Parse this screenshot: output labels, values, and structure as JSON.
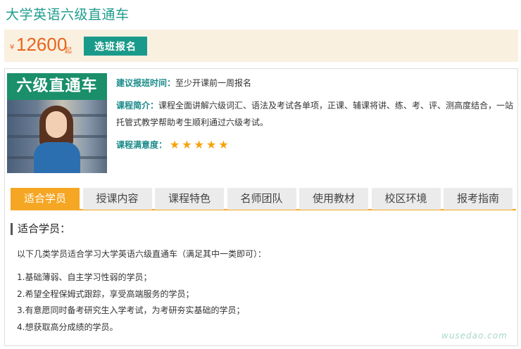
{
  "page": {
    "title": "大学英语六级直通车"
  },
  "price": {
    "currency": "¥",
    "value": "12600",
    "unit": "起"
  },
  "enroll_button": "选班报名",
  "cover": {
    "title": "六级直通车"
  },
  "info": {
    "schedule_label": "建议报班时间：",
    "schedule_value": "至少开课前一周报名",
    "intro_label": "课程简介：",
    "intro_value": "课程全面讲解六级词汇、语法及考试各单项，正课、辅课将讲、练、考、评、测高度结合，一站托管式教学帮助考生顺利通过六级考试。",
    "rating_label": "课程满意度：",
    "rating": 5
  },
  "tabs": [
    "适合学员",
    "授课内容",
    "课程特色",
    "名师团队",
    "使用教材",
    "校区环境",
    "报考指南"
  ],
  "active_tab": 0,
  "section": {
    "title": "适合学员：",
    "intro": "以下几类学员适合学习大学英语六级直通车（满足其中一类即可）：",
    "items": [
      "1.基础薄弱、自主学习性弱的学员；",
      "2.希望全程保姆式跟踪，享受高端服务的学员；",
      "3.有意愿同时备考研究生入学考试，为考研夯实基础的学员；",
      "4.想获取高分成绩的学员。"
    ]
  },
  "watermark": "wusedao.com",
  "colors": {
    "accent": "#1a9a8a",
    "price": "#e8651e",
    "tab_active": "#f5a623",
    "star": "#f5a20a"
  }
}
